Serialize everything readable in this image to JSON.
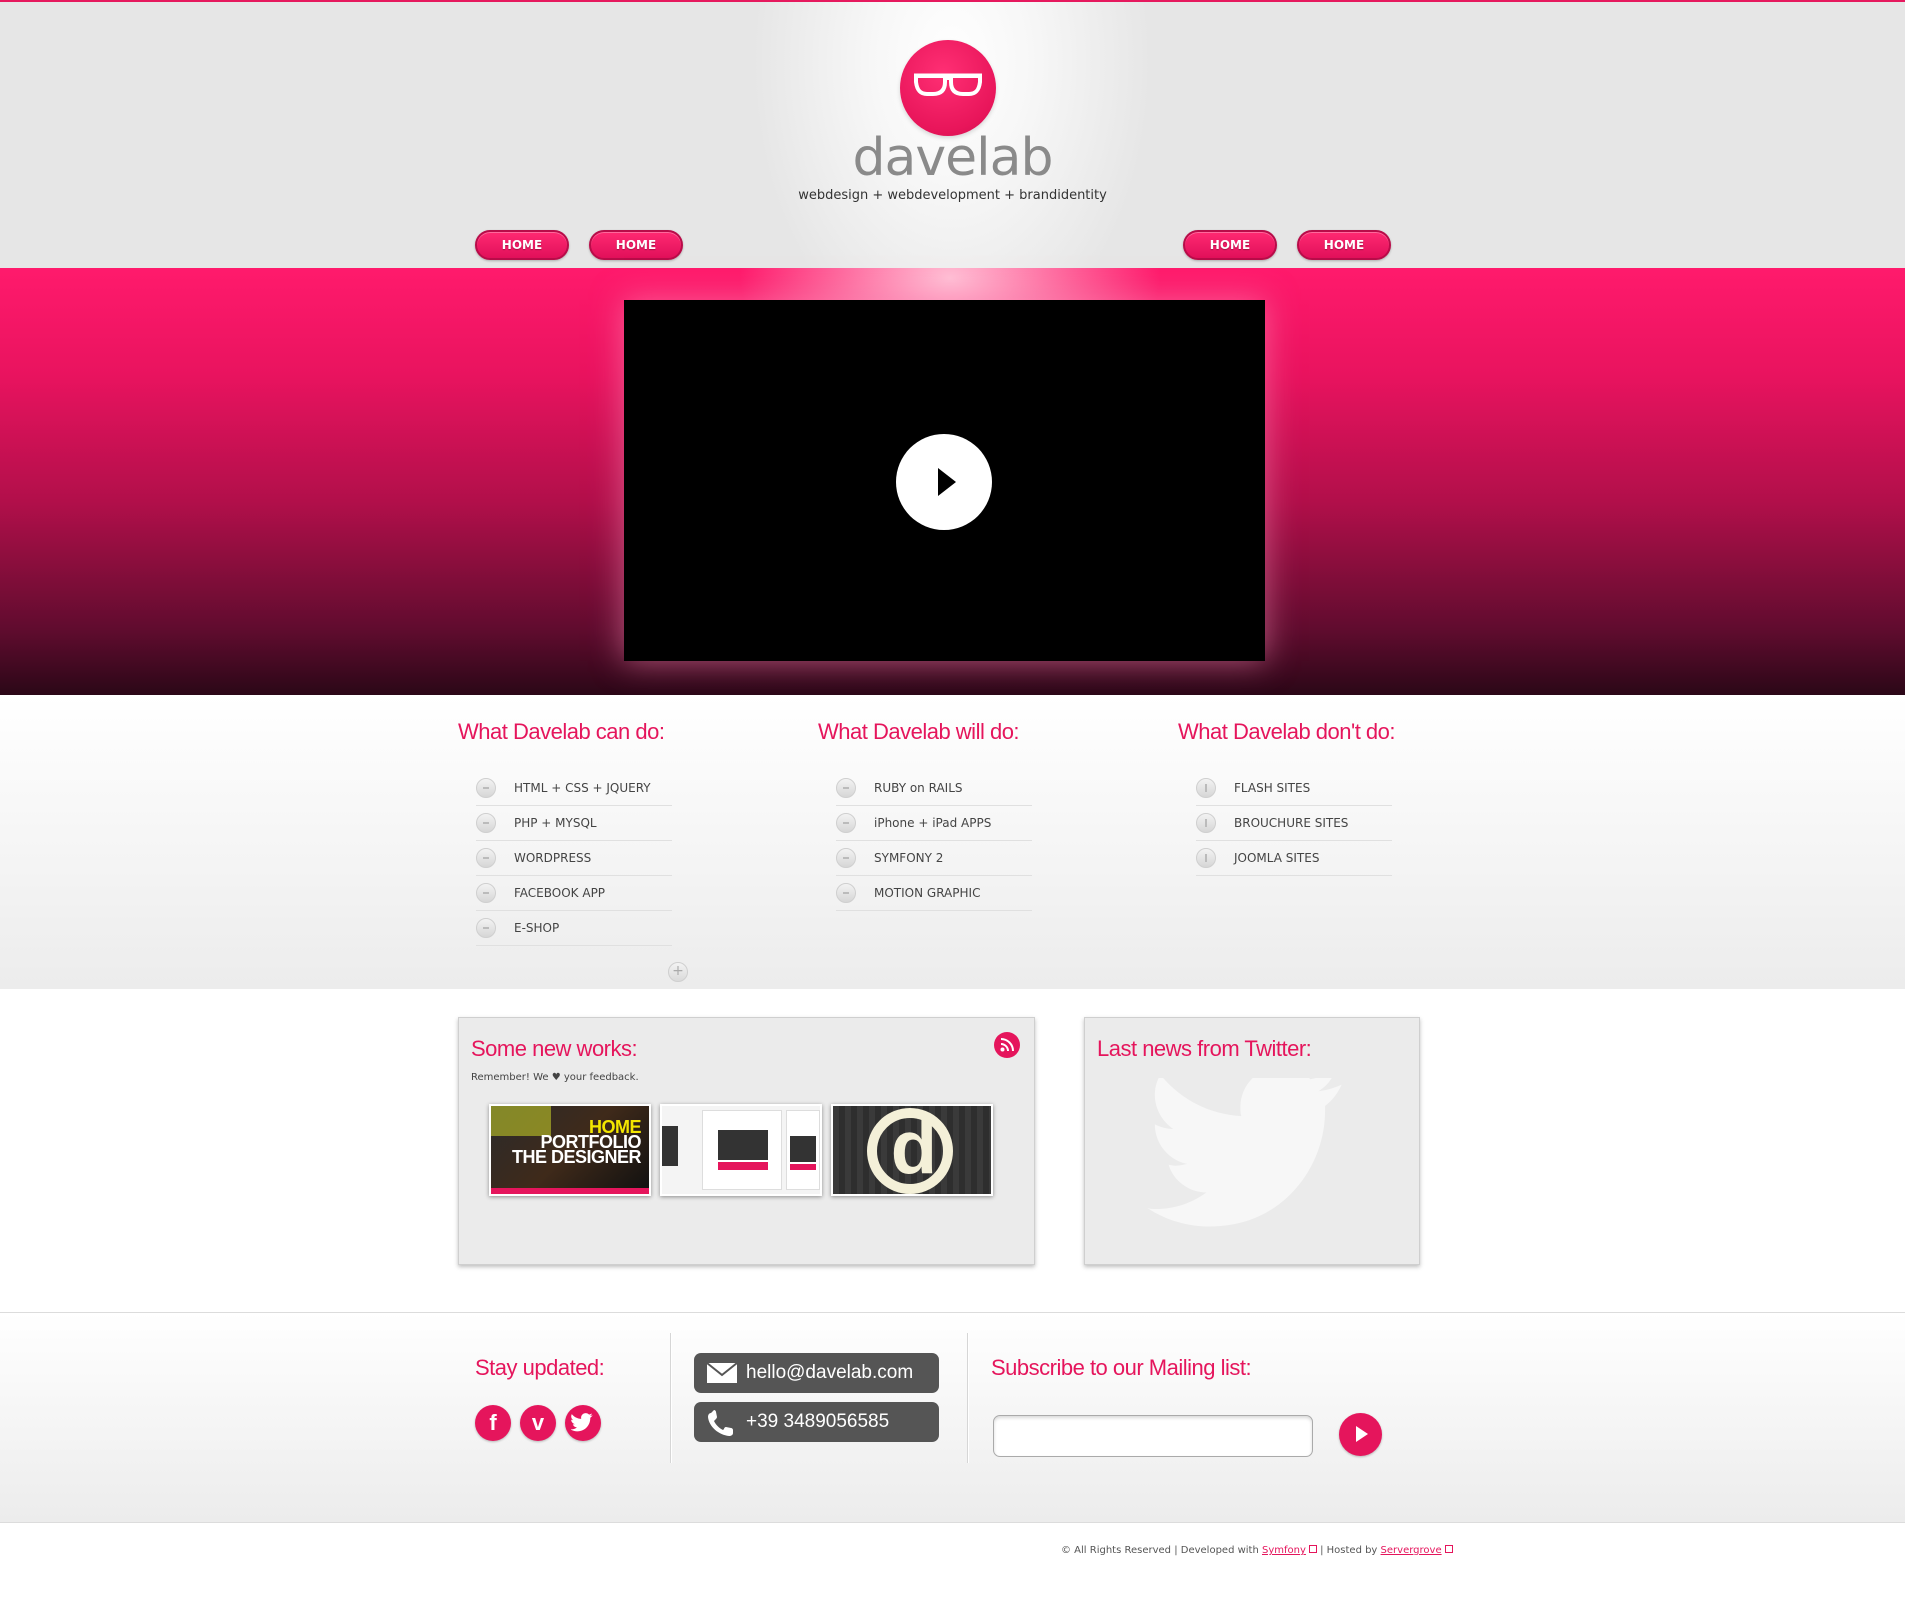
{
  "header": {
    "logo_word": "davelab",
    "tagline": "webdesign + webdevelopment + brandidentity",
    "nav": [
      "HOME",
      "HOME",
      "HOME",
      "HOME"
    ]
  },
  "services": {
    "can": {
      "title": "What Davelab can do:",
      "items": [
        "HTML + CSS + JQUERY",
        "PHP + MYSQL",
        "WORDPRESS",
        "FACEBOOK APP",
        "E-SHOP"
      ]
    },
    "will": {
      "title": "What Davelab will do:",
      "items": [
        "RUBY on RAILS",
        "iPhone + iPad APPS",
        "SYMFONY 2",
        "MOTION GRAPHIC"
      ]
    },
    "dont": {
      "title": "What Davelab don't do:",
      "items": [
        "FLASH SITES",
        "BROUCHURE SITES",
        "JOOMLA SITES"
      ]
    },
    "more_symbol": "+"
  },
  "works": {
    "title": "Some new works:",
    "subtitle": "Remember! We ♥ your feedback.",
    "thumb1_lines": [
      "HOME",
      "PORTFOLIO",
      "THE DESIGNER"
    ],
    "thumb3_letter": "d"
  },
  "twitter": {
    "title": "Last news from Twitter:"
  },
  "footer": {
    "stay_title": "Stay updated:",
    "social": [
      "f",
      "v"
    ],
    "email": "hello@davelab.com",
    "phone": "+39 3489056585",
    "mailing_title": "Subscribe to our Mailing list:",
    "mailing_input_value": ""
  },
  "bottom": {
    "prefix": "© All Rights Reserved | Developed with",
    "symfony": "Symfony",
    "hosted": "| Hosted by",
    "host": "Servergrove"
  },
  "colors": {
    "accent": "#e5155c",
    "hero_top": "#ff1a6c",
    "hero_bottom": "#2b0717",
    "contact_bg": "#555555"
  },
  "icons": [
    "glasses-logo-icon",
    "play-icon",
    "rss-icon",
    "twitter-bird-icon",
    "facebook-icon",
    "vimeo-icon",
    "twitter-icon",
    "envelope-icon",
    "phone-icon",
    "arrow-right-icon",
    "external-link-icon"
  ]
}
